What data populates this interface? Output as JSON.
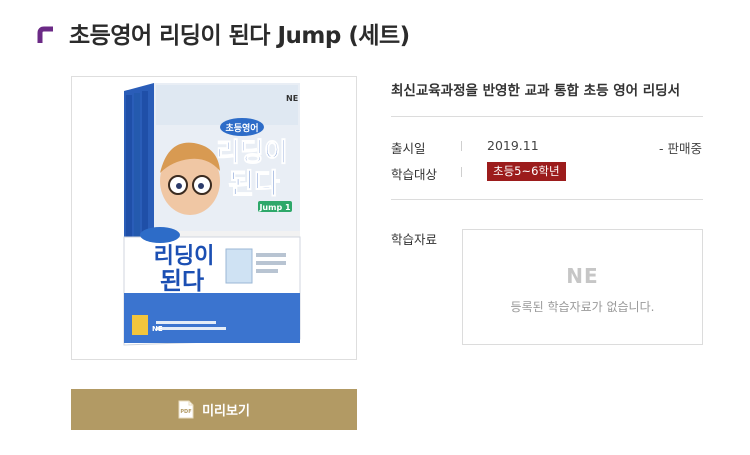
{
  "header": {
    "title": "초등영어 리딩이 된다 Jump (세트)",
    "accent_color": "#6b2a86",
    "title_icon": "corner-bracket-icon"
  },
  "cover": {
    "image": "book-set-cover",
    "publisher_mark": "NE",
    "box_title_small": "초등영어",
    "box_title_line1": "리딩이",
    "box_title_line2": "된다",
    "box_level": "Jump 1",
    "spine_title": "초등영어 리딩이 된다",
    "spine_brand": "NE"
  },
  "preview": {
    "label": "미리보기",
    "icon": "pdf-file-icon",
    "icon_text": "PDF",
    "color": "#b29a64"
  },
  "product": {
    "subtitle": "최신교육과정을 반영한 교과 통합 초등 영어 리딩서",
    "release_label": "출시일",
    "release_value": "2019.11",
    "status": "- 판매중",
    "target_label": "학습대상",
    "target_value": "초등5~6학년",
    "badge_color": "#9c1c1c"
  },
  "materials": {
    "label": "학습자료",
    "logo": "NE",
    "empty_message": "등록된 학습자료가 없습니다."
  }
}
